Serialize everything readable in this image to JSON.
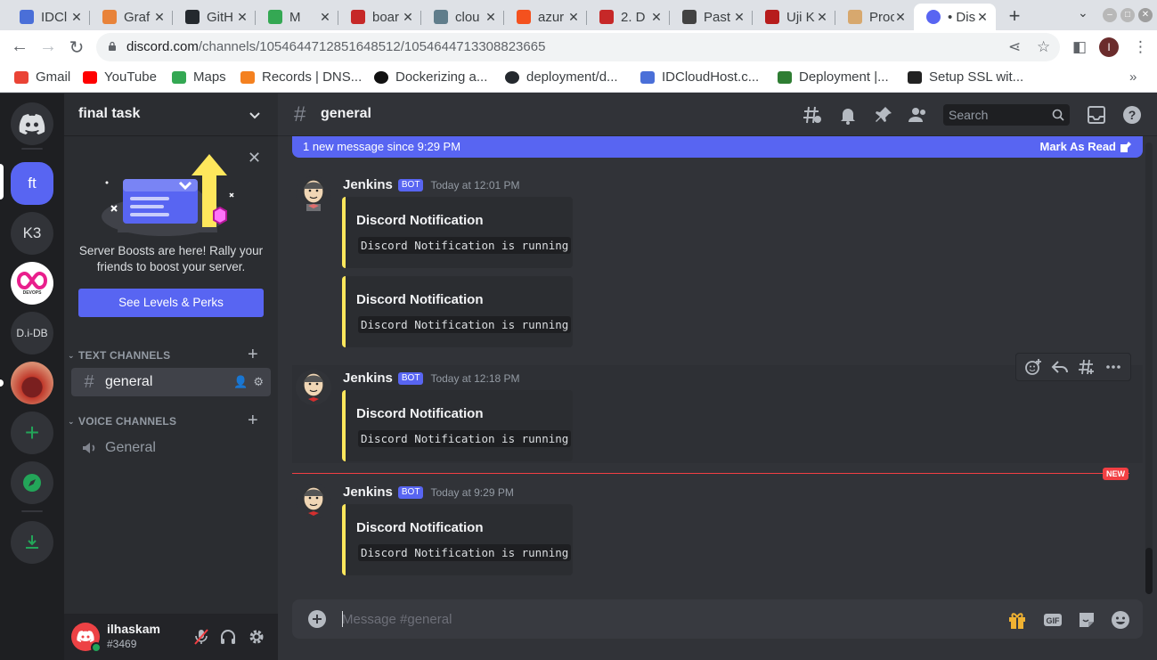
{
  "browser": {
    "tabs": [
      {
        "title": "IDCl",
        "color": "#4a6fd8"
      },
      {
        "title": "Graf",
        "color": "#e8833a"
      },
      {
        "title": "GitH",
        "color": "#24292e"
      },
      {
        "title": "M",
        "color": "#34a853"
      },
      {
        "title": "boar",
        "color": "#c62828"
      },
      {
        "title": "clou",
        "color": "#607d8b"
      },
      {
        "title": "azur",
        "color": "#f4511e"
      },
      {
        "title": "2. D",
        "color": "#c62828"
      },
      {
        "title": "Past",
        "color": "#424242"
      },
      {
        "title": "Uji K",
        "color": "#b71c1c"
      },
      {
        "title": "Proc",
        "color": "#d7a86e"
      },
      {
        "title": "• Dis",
        "color": "#5865f2"
      }
    ],
    "url_host": "discord.com",
    "url_path": "/channels/1054644712851648512/1054644713308823665",
    "profile_initial": "I",
    "bookmarks": [
      {
        "label": "Gmail",
        "color": "#ea4335"
      },
      {
        "label": "YouTube",
        "color": "#ff0000"
      },
      {
        "label": "Maps",
        "color": "#34a853"
      },
      {
        "label": "Records | DNS...",
        "color": "#f48120"
      },
      {
        "label": "Dockerizing a...",
        "color": "#111111"
      },
      {
        "label": "deployment/d...",
        "color": "#24292e"
      },
      {
        "label": "IDCloudHost.c...",
        "color": "#4a6fd8"
      },
      {
        "label": "Deployment |...",
        "color": "#2e7d32"
      },
      {
        "label": "Setup SSL wit...",
        "color": "#222222"
      }
    ],
    "bookmarks_more": "»"
  },
  "guilds": [
    {
      "label": "ft",
      "bg": "#5865f2"
    },
    {
      "label": "K3",
      "bg": "#313338"
    },
    {
      "label": "DEVOPS",
      "bg": "#ffffff"
    },
    {
      "label": "D.i-DB",
      "bg": "#313338"
    },
    {
      "label": "",
      "bg": "#c0392b"
    }
  ],
  "server": {
    "name": "final task",
    "boost_text": "Server Boosts are here! Rally your friends to boost your server.",
    "boost_button": "See Levels & Perks",
    "text_category": "TEXT CHANNELS",
    "voice_category": "VOICE CHANNELS",
    "text_channels": [
      {
        "name": "general"
      }
    ],
    "voice_channels": [
      {
        "name": "General"
      }
    ]
  },
  "user": {
    "name": "ilhaskam",
    "tag": "#3469"
  },
  "chat": {
    "channel": "general",
    "search_placeholder": "Search",
    "new_messages_text": "1 new message since 9:29 PM",
    "mark_read": "Mark As Read",
    "new_label": "NEW",
    "composer_placeholder": "Message #general",
    "messages": [
      {
        "author": "Jenkins",
        "badge": "BOT",
        "timestamp": "Today at 12:01 PM",
        "embeds": [
          {
            "title": "Discord Notification",
            "description": "Discord Notification is running"
          },
          {
            "title": "Discord Notification",
            "description": "Discord Notification is running"
          }
        ]
      },
      {
        "author": "Jenkins",
        "badge": "BOT",
        "timestamp": "Today at 12:18 PM",
        "embeds": [
          {
            "title": "Discord Notification",
            "description": "Discord Notification is running"
          }
        ]
      },
      {
        "author": "Jenkins",
        "badge": "BOT",
        "timestamp": "Today at 9:29 PM",
        "embeds": [
          {
            "title": "Discord Notification",
            "description": "Discord Notification is running"
          }
        ]
      }
    ]
  },
  "colors": {
    "blurple": "#5865f2",
    "embed_accent": "#fee75c",
    "new_red": "#f23f43",
    "green": "#23a559"
  }
}
